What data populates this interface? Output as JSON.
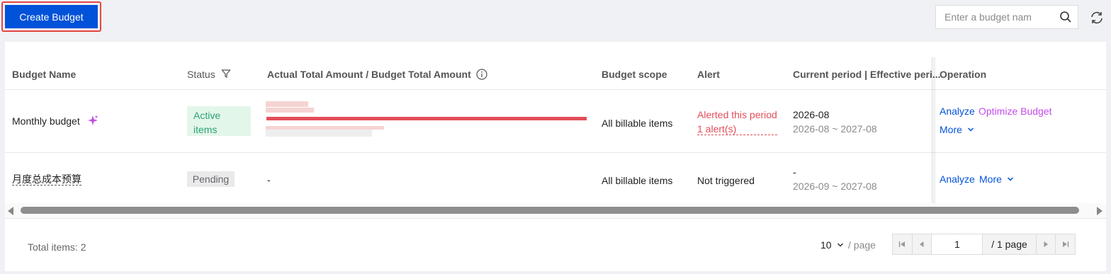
{
  "toolbar": {
    "create_label": "Create Budget",
    "search_placeholder": "Enter a budget nam"
  },
  "table": {
    "headers": {
      "name": "Budget Name",
      "status": "Status",
      "amount": "Actual Total Amount / Budget Total Amount",
      "scope": "Budget scope",
      "alert": "Alert",
      "period": "Current period | Effective peri...",
      "operation": "Operation"
    },
    "rows": [
      {
        "name": "Monthly budget",
        "status": "Active items",
        "scope": "All billable items",
        "alert_status": "Alerted this period",
        "alert_count": "1 alert(s)",
        "current_period": "2026-08",
        "effective_period": "2026-08 ~ 2027-08",
        "analyze": "Analyze",
        "optimize": "Optimize Budget",
        "more": "More",
        "amount_progress": 1.0
      },
      {
        "name": "月度总成本预算",
        "status": "Pending",
        "amount": "-",
        "scope": "All billable items",
        "alert_status": "Not triggered",
        "current_period": "-",
        "effective_period": "2026-09 ~ 2027-08",
        "analyze": "Analyze",
        "more": "More"
      }
    ]
  },
  "footer": {
    "total": "Total items: 2",
    "page_size": "10",
    "per_page": "/ page",
    "current_page": "1",
    "total_pages": "/ 1 page"
  },
  "colors": {
    "primary": "#0052d9",
    "danger": "#e34d59",
    "success": "#2ba471",
    "ai_purple": "#c34bea"
  }
}
